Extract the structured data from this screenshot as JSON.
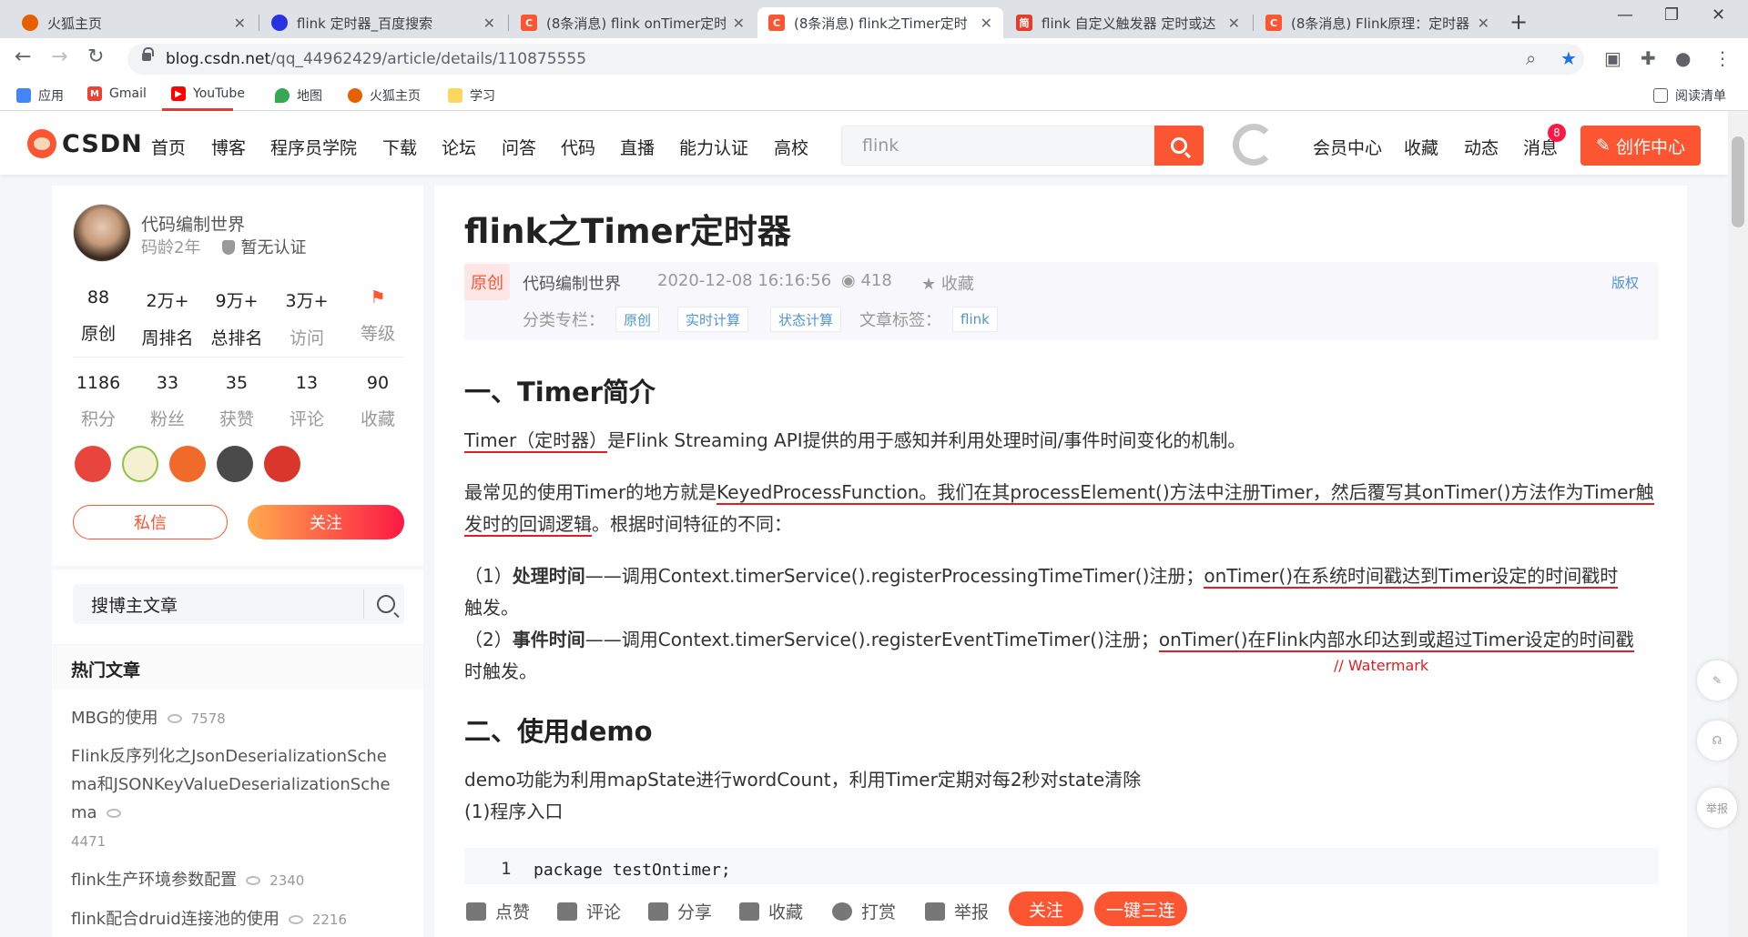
{
  "browser": {
    "tabs": [
      {
        "title": "火狐主页",
        "color": "#e66000"
      },
      {
        "title": "flink 定时器_百度搜索",
        "color": "#2932e1"
      },
      {
        "title": "(8条消息) flink onTimer定时",
        "color": "#fc5531"
      },
      {
        "title": "(8条消息) flink之Timer定时",
        "color": "#fc5531"
      },
      {
        "title": "flink 自定义触发器 定时或达",
        "color": "#e33e2b"
      },
      {
        "title": "(8条消息) Flink原理：定时器",
        "color": "#fc5531"
      }
    ],
    "new_tab": "+",
    "url_host": "blog.csdn.net",
    "url_path": "/qq_44962429/article/details/110875555",
    "bookmarks": [
      {
        "label": "应用"
      },
      {
        "label": "Gmail"
      },
      {
        "label": "YouTube"
      },
      {
        "label": "地图"
      },
      {
        "label": "火狐主页"
      },
      {
        "label": "学习"
      }
    ],
    "reading_list": "阅读清单"
  },
  "csdn": {
    "logo": "CSDN",
    "nav": [
      "首页",
      "博客",
      "程序员学院",
      "下载",
      "论坛",
      "问答",
      "代码",
      "直播",
      "能力认证",
      "高校"
    ],
    "search_value": "flink",
    "links": [
      "会员中心",
      "收藏",
      "动态",
      "消息"
    ],
    "msg_count": "8",
    "create": "创作中心"
  },
  "profile": {
    "name": "代码编制世界",
    "age": "码龄2年",
    "cert": "暂无认证",
    "stats1": [
      {
        "n": "88",
        "l": "原创"
      },
      {
        "n": "2万+",
        "l": "周排名"
      },
      {
        "n": "9万+",
        "l": "总排名"
      },
      {
        "n": "3万+",
        "l": "访问"
      },
      {
        "n": "",
        "l": "等级"
      }
    ],
    "stats2": [
      {
        "n": "1186",
        "l": "积分"
      },
      {
        "n": "33",
        "l": "粉丝"
      },
      {
        "n": "35",
        "l": "获赞"
      },
      {
        "n": "13",
        "l": "评论"
      },
      {
        "n": "90",
        "l": "收藏"
      }
    ],
    "message": "私信",
    "follow": "关注",
    "search_placeholder": "搜博主文章",
    "hot_title": "热门文章",
    "hot": [
      {
        "title": "MBG的使用",
        "views": "7578"
      },
      {
        "title": "Flink反序列化之JsonDeserializationSchema和JSONKeyValueDeserializationSchema",
        "views": "4471"
      },
      {
        "title": "flink生产环境参数配置",
        "views": "2340"
      },
      {
        "title": "flink配合druid连接池的使用",
        "views": "2216"
      }
    ]
  },
  "article": {
    "title": "flink之Timer定时器",
    "badge": "原创",
    "author": "代码编制世界",
    "date": "2020-12-08 16:16:56",
    "views": "418",
    "fav": "收藏",
    "copyright": "版权",
    "cat_label": "分类专栏：",
    "cats": [
      "原创",
      "实时计算",
      "状态计算"
    ],
    "tag_label": "文章标签：",
    "tags": [
      "flink"
    ],
    "h1": "一、Timer简介",
    "p1a": "Timer（定时器）",
    "p1b": "是Flink Streaming API提供的用于感知并利用处理时间/事件时间变化的机制。",
    "p2a": "最常见的使用Timer的地方就是",
    "p2b": "KeyedProcessFunction。我们在其processElement()方法中注册Timer，然后覆写其onTimer()方法作为Timer触发时的回调逻辑",
    "p2c": "。根据时间特征的不同：",
    "p3a": "（1）",
    "p3b": "处理时间",
    "p3c": "——调用Context.timerService().registerProcessingTimeTimer()注册；",
    "p3d": "onTimer()在系统时间戳达到Timer设定的时间戳时",
    "p3e": "触发。",
    "p4a": "（2）",
    "p4b": "事件时间",
    "p4c": "——调用Context.timerService().registerEventTimeTimer()注册；",
    "p4d": "onTimer()在Flink内部水印达到或超过Timer设定的时间戳",
    "p4e": "时触发。",
    "note": "// Watermark",
    "h2": "二、使用demo",
    "p5": "demo功能为利用mapState进行wordCount，利用Timer定期对每2秒对state清除",
    "p6": "(1)程序入口",
    "code_line": "1",
    "code_text": "package testOntimer;"
  },
  "toolbar": {
    "like": "点赞",
    "comment": "评论",
    "share": "分享",
    "collect": "收藏",
    "reward": "打赏",
    "report": "举报",
    "follow": "关注",
    "triple": "一键三连"
  },
  "float": {
    "report": "举报"
  }
}
